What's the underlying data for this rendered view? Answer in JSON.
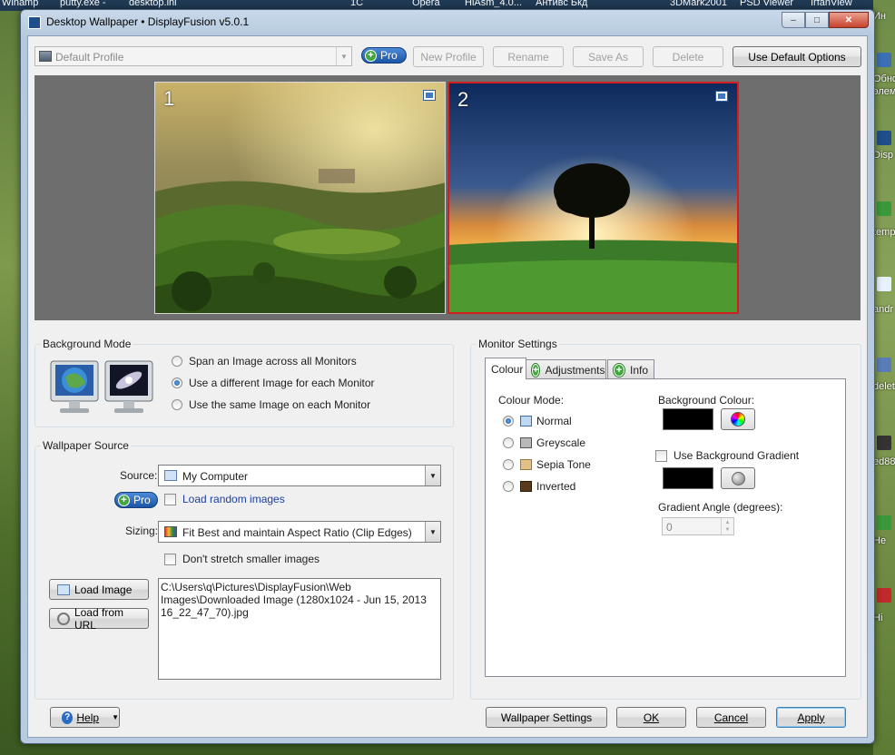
{
  "desktop": {
    "top_labels": [
      "Winamp",
      "putty.exe -",
      "desktop.ini",
      "1C",
      "Opera",
      "HiAsm_4.0...",
      "Антивс Бкд",
      "3DMark2001",
      "PSD Viewer",
      "IrfanView"
    ],
    "right_labels": [
      "Ин",
      "Обно элем",
      "Disp",
      "temp",
      "andr",
      "delet",
      "ed88",
      "He",
      "Hi"
    ]
  },
  "window": {
    "title": "Desktop Wallpaper • DisplayFusion v5.0.1",
    "minimize": "–",
    "maximize": "□",
    "close": "✕"
  },
  "toolbar": {
    "profile": "Default Profile",
    "pro": "Pro",
    "new_profile": "New Profile",
    "rename": "Rename",
    "save_as": "Save As",
    "delete": "Delete",
    "use_default": "Use Default Options"
  },
  "preview": {
    "monitor1": "1",
    "monitor2": "2"
  },
  "background_mode": {
    "title": "Background Mode",
    "options": [
      "Span an Image across all Monitors",
      "Use a different Image for each Monitor",
      "Use the same Image on each Monitor"
    ],
    "selected_index": 1
  },
  "wallpaper_source": {
    "title": "Wallpaper Source",
    "source_label": "Source:",
    "source_value": "My Computer",
    "pro": "Pro",
    "load_random": "Load random images",
    "sizing_label": "Sizing:",
    "sizing_value": "Fit Best and maintain Aspect Ratio (Clip Edges)",
    "dont_stretch": "Don't stretch smaller images",
    "load_image": "Load Image",
    "load_url": "Load from URL",
    "path": "C:\\Users\\q\\Pictures\\DisplayFusion\\Web Images\\Downloaded Image (1280x1024 - Jun 15, 2013 16_22_47_70).jpg"
  },
  "monitor_settings": {
    "title": "Monitor Settings",
    "tabs": [
      "Colour",
      "Adjustments",
      "Info"
    ],
    "active_tab": "Colour",
    "colour_mode_label": "Colour Mode:",
    "modes": [
      "Normal",
      "Greyscale",
      "Sepia Tone",
      "Inverted"
    ],
    "selected_mode": "Normal",
    "bg_colour_label": "Background Colour:",
    "bg_colour": "#000000",
    "use_gradient": "Use Background Gradient",
    "gradient_colour": "#000000",
    "gradient_angle_label": "Gradient Angle (degrees):",
    "gradient_angle": "0"
  },
  "footer": {
    "help": "Help",
    "wallpaper_settings": "Wallpaper Settings",
    "ok": "OK",
    "cancel": "Cancel",
    "apply": "Apply"
  },
  "colors": {
    "selected_monitor_border": "#d21e1e",
    "pro_blue": "#1c55a8",
    "plus_green": "#3ea83b"
  }
}
